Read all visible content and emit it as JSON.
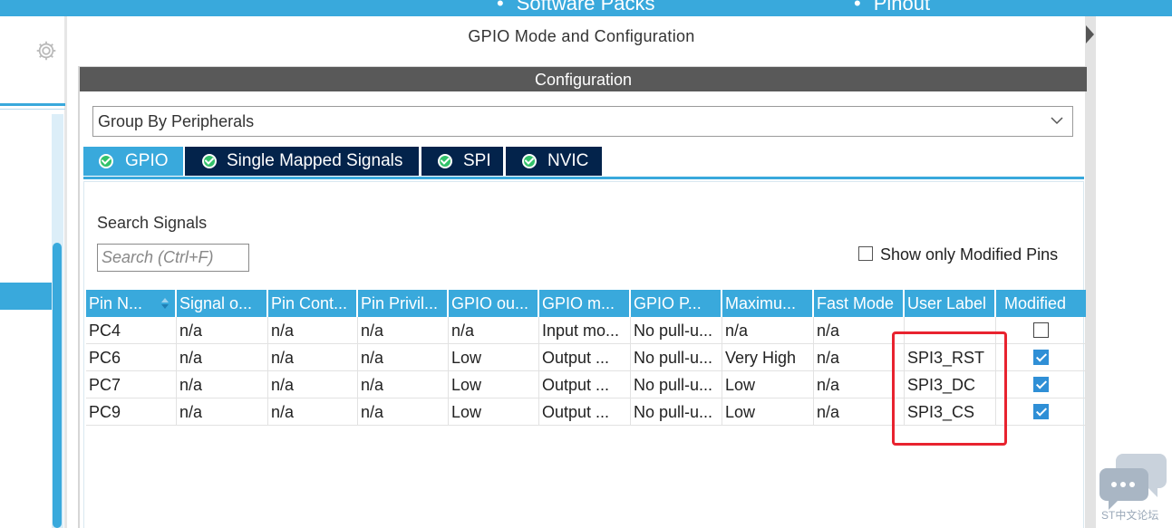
{
  "topbar": {
    "items": [
      "Software Packs",
      "Pinout"
    ]
  },
  "panel": {
    "title": "GPIO Mode and Configuration",
    "config_header": "Configuration",
    "group_by": "Group By Peripherals"
  },
  "tabs": [
    {
      "label": "GPIO",
      "active": true
    },
    {
      "label": "Single Mapped Signals",
      "active": false
    },
    {
      "label": "SPI",
      "active": false
    },
    {
      "label": "NVIC",
      "active": false
    }
  ],
  "search": {
    "label": "Search Signals",
    "placeholder": "Search (Ctrl+F)",
    "show_modified_label": "Show only Modified Pins",
    "show_modified_checked": false
  },
  "table": {
    "columns": [
      "Pin N...",
      "Signal o...",
      "Pin Cont...",
      "Pin Privil...",
      "GPIO ou...",
      "GPIO m...",
      "GPIO P...",
      "Maximu...",
      "Fast Mode",
      "User Label",
      "Modified"
    ],
    "rows": [
      {
        "cells": [
          "PC4",
          "n/a",
          "n/a",
          "n/a",
          "n/a",
          "Input mo...",
          "No pull-u...",
          "n/a",
          "n/a",
          ""
        ],
        "modified": false
      },
      {
        "cells": [
          "PC6",
          "n/a",
          "n/a",
          "n/a",
          "Low",
          "Output ...",
          "No pull-u...",
          "Very High",
          "n/a",
          "SPI3_RST"
        ],
        "modified": true
      },
      {
        "cells": [
          "PC7",
          "n/a",
          "n/a",
          "n/a",
          "Low",
          "Output ...",
          "No pull-u...",
          "Low",
          "n/a",
          "SPI3_DC"
        ],
        "modified": true
      },
      {
        "cells": [
          "PC9",
          "n/a",
          "n/a",
          "n/a",
          "Low",
          "Output ...",
          "No pull-u...",
          "Low",
          "n/a",
          "SPI3_CS"
        ],
        "modified": true
      }
    ]
  },
  "watermark": {
    "text": "ST中文论坛"
  },
  "colors": {
    "accent": "#39a9dc",
    "tab_dark": "#03234b",
    "config_header": "#595959",
    "highlight_box": "#e8232f",
    "checkbox_on": "#2f8fd6"
  }
}
